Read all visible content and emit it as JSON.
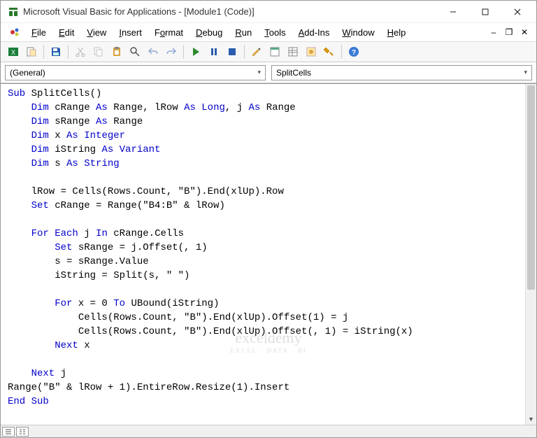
{
  "window": {
    "title": "Microsoft Visual Basic for Applications - [Module1 (Code)]"
  },
  "menu": {
    "file": "File",
    "edit": "Edit",
    "view": "View",
    "insert": "Insert",
    "format": "Format",
    "debug": "Debug",
    "run": "Run",
    "tools": "Tools",
    "addins": "Add-Ins",
    "window": "Window",
    "help": "Help"
  },
  "dropdown": {
    "left": "(General)",
    "right": "SplitCells"
  },
  "code": {
    "l1a": "Sub",
    "l1b": " SplitCells()",
    "l2a": "    Dim",
    "l2b": " cRange ",
    "l2c": "As",
    "l2d": " Range, lRow ",
    "l2e": "As Long",
    "l2f": ", j ",
    "l2g": "As",
    "l2h": " Range",
    "l3a": "    Dim",
    "l3b": " sRange ",
    "l3c": "As",
    "l3d": " Range",
    "l4a": "    Dim",
    "l4b": " x ",
    "l4c": "As Integer",
    "l5a": "    Dim",
    "l5b": " iString ",
    "l5c": "As Variant",
    "l6a": "    Dim",
    "l6b": " s ",
    "l6c": "As String",
    "l8": "    lRow = Cells(Rows.Count, \"B\").End(xlUp).Row",
    "l9a": "    Set",
    "l9b": " cRange = Range(\"B4:B\" & lRow)",
    "l11a": "    For Each",
    "l11b": " j ",
    "l11c": "In",
    "l11d": " cRange.Cells",
    "l12a": "        Set",
    "l12b": " sRange = j.Offset(, 1)",
    "l13": "        s = sRange.Value",
    "l14": "        iString = Split(s, \" \")",
    "l16a": "        For",
    "l16b": " x = 0 ",
    "l16c": "To",
    "l16d": " UBound(iString)",
    "l17": "            Cells(Rows.Count, \"B\").End(xlUp).Offset(1) = j",
    "l18": "            Cells(Rows.Count, \"B\").End(xlUp).Offset(, 1) = iString(x)",
    "l19a": "        Next",
    "l19b": " x",
    "l21a": "    Next",
    "l21b": " j",
    "l22": "Range(\"B\" & lRow + 1).EntireRow.Resize(1).Insert",
    "l23": "End Sub"
  },
  "watermark": {
    "main": "exceldemy",
    "sub": "EXCEL · DATA · BI"
  }
}
